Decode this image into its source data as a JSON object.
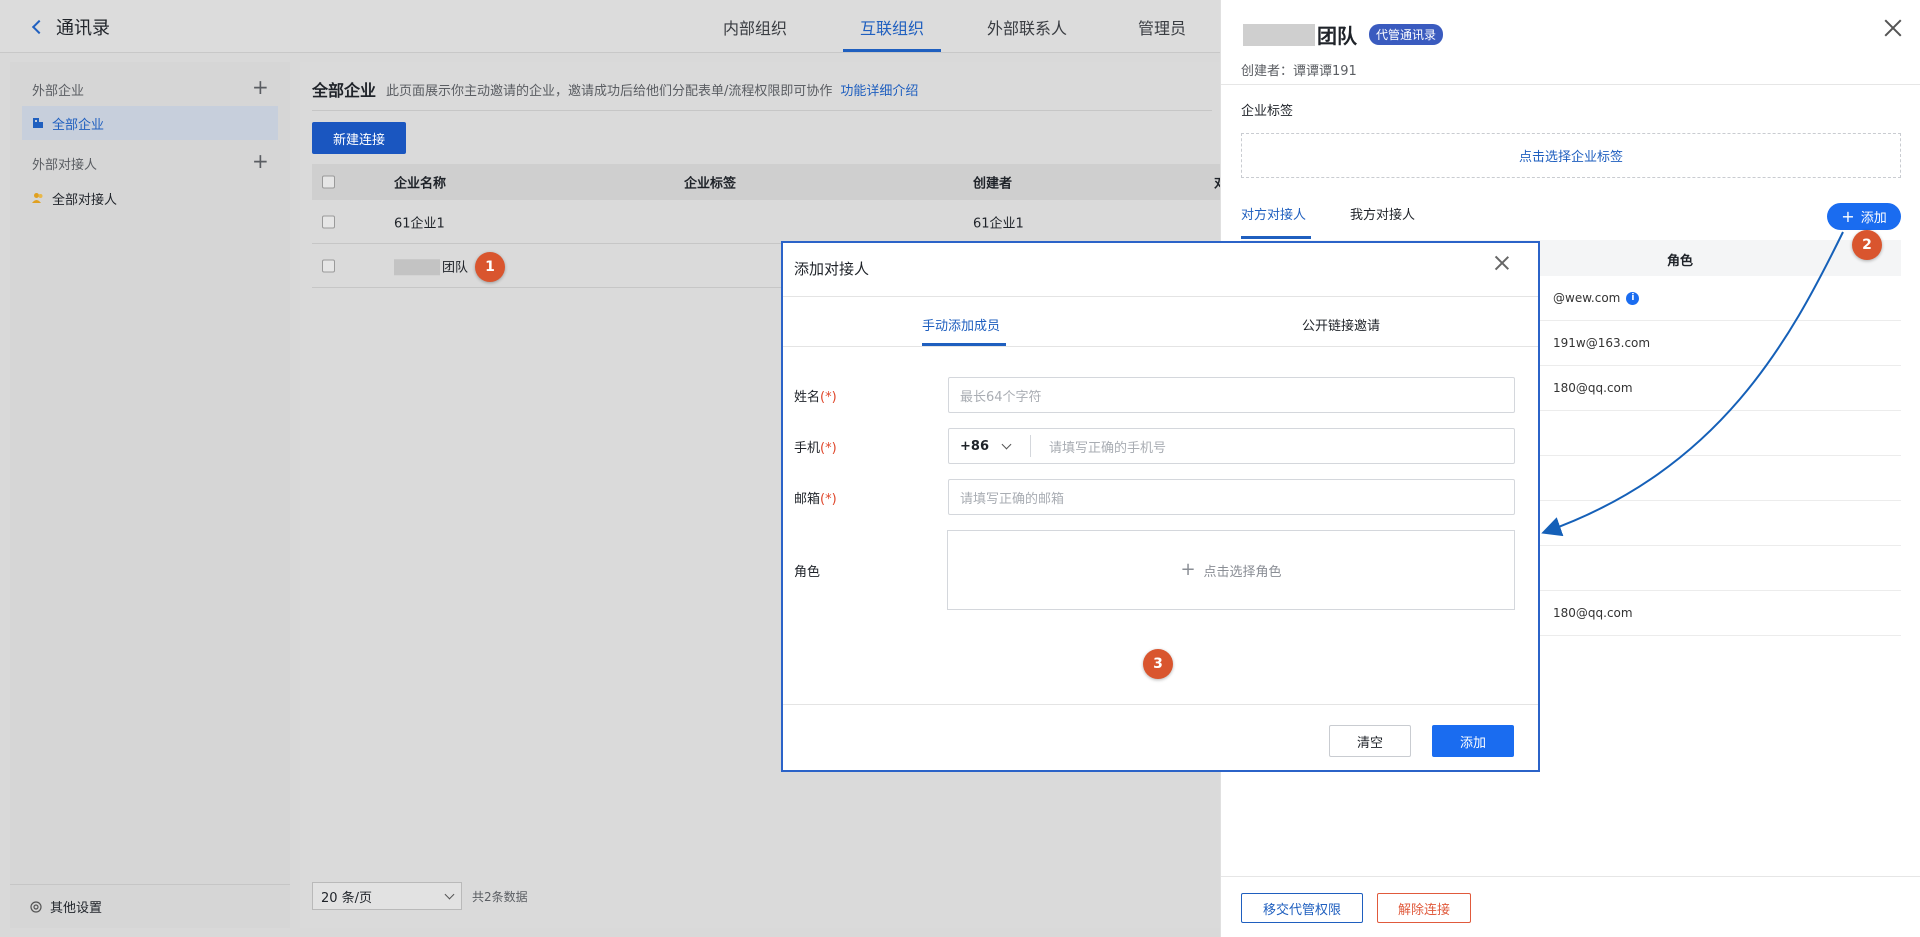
{
  "header": {
    "back_label": "通讯录",
    "tabs": [
      "内部组织",
      "互联组织",
      "外部联系人",
      "管理员"
    ]
  },
  "sidebar": {
    "group_companies": "外部企业",
    "item_all_companies": "全部企业",
    "group_contacts": "外部对接人",
    "item_all_contacts": "全部对接人",
    "footer": "其他设置"
  },
  "main": {
    "title": "全部企业",
    "desc": "此页面展示你主动邀请的企业，邀请成功后给他们分配表单/流程权限即可协作",
    "desc_link": "功能详细介绍",
    "new_button": "新建连接",
    "columns": [
      "企业名称",
      "企业标签",
      "创建者",
      "对"
    ],
    "rows": [
      {
        "name": "61企业1",
        "creator": "61企业1"
      },
      {
        "name": "团队",
        "creator": ""
      }
    ],
    "pager_size": "20 条/页",
    "pager_total": "共2条数据"
  },
  "drawer": {
    "title": "团队",
    "tag": "代管通讯录",
    "creator": "创建者：谭谭谭191",
    "tags_label": "企业标签",
    "tags_placeholder": "点击选择企业标签",
    "tab_partner": "对方对接人",
    "tab_ours": "我方对接人",
    "add_button": "添加",
    "role_header": "角色",
    "emails": [
      "@wew.com",
      "191w@163.com",
      "180@qq.com",
      "",
      "",
      "",
      "",
      "180@qq.com"
    ],
    "transfer_button": "移交代管权限",
    "release_button": "解除连接"
  },
  "modal": {
    "title": "添加对接人",
    "tab_manual": "手动添加成员",
    "tab_link": "公开链接邀请",
    "name_label": "姓名",
    "name_placeholder": "最长64个字符",
    "phone_label": "手机",
    "country_code": "+86",
    "phone_placeholder": "请填写正确的手机号",
    "email_label": "邮箱",
    "email_placeholder": "请填写正确的邮箱",
    "role_label": "角色",
    "role_placeholder": "点击选择角色",
    "required_mark": "(*)",
    "clear_button": "清空",
    "submit_button": "添加"
  },
  "annotations": [
    "1",
    "2",
    "3"
  ],
  "colors": {
    "accent": "#1a6cf0",
    "annotation": "#d9552e",
    "danger": "#e05a3c",
    "arrow": "#1560b8"
  }
}
